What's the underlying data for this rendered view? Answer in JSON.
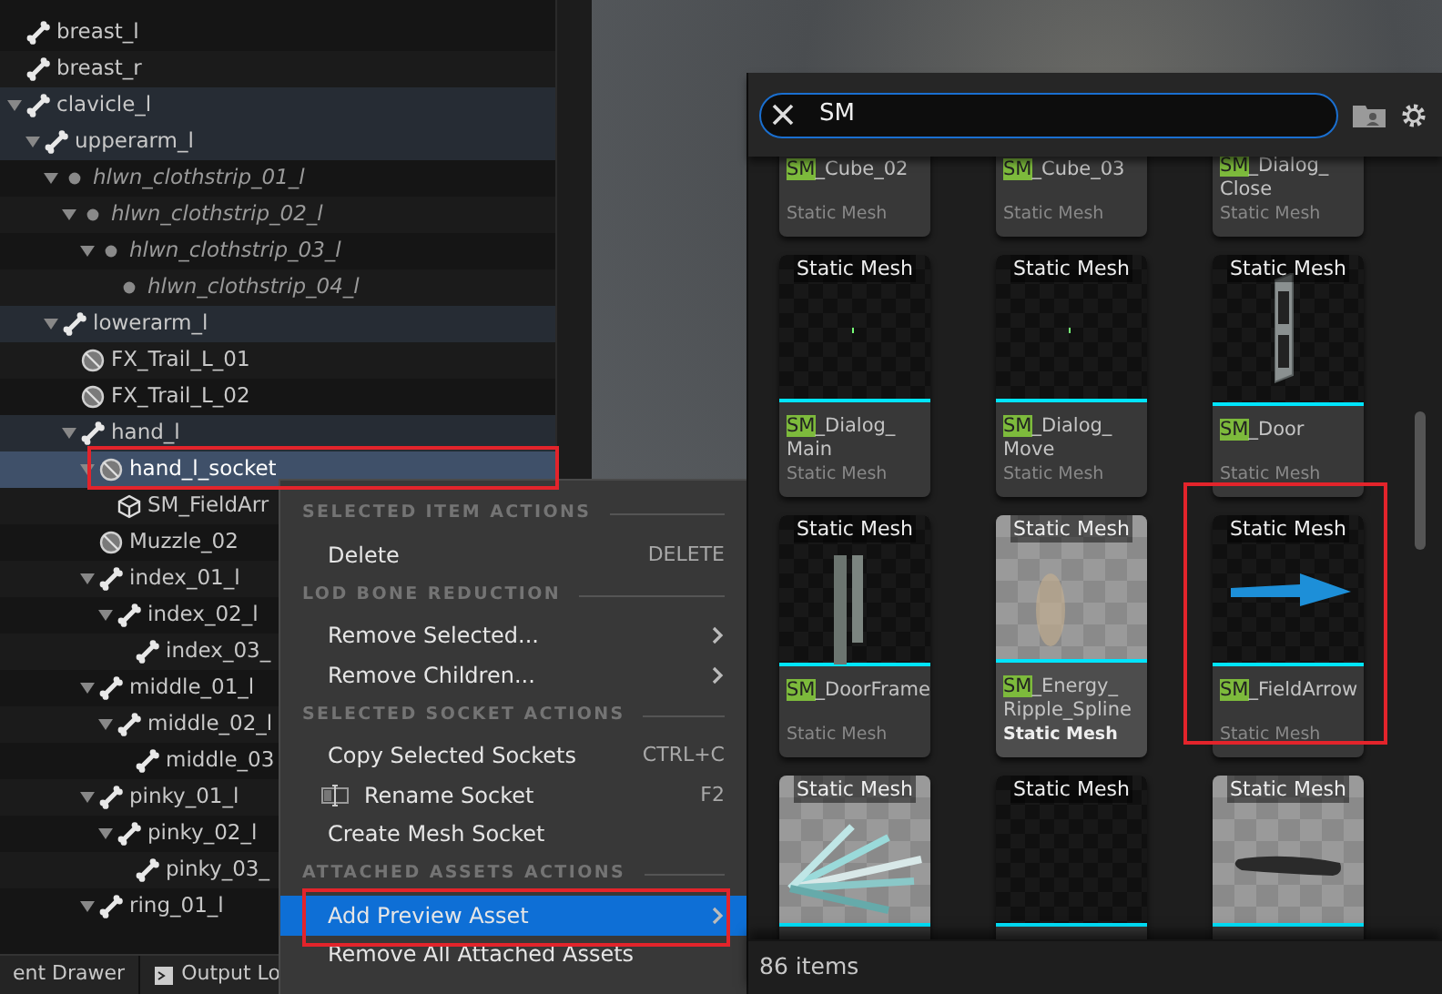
{
  "tree": [
    {
      "label": "breast_l",
      "kind": "bone",
      "selected": false,
      "in_path": false
    },
    {
      "label": "breast_r",
      "kind": "bone",
      "selected": false,
      "in_path": false
    },
    {
      "label": "clavicle_l",
      "kind": "bone",
      "selected": false,
      "in_path": true,
      "expanded": true,
      "children": [
        {
          "label": "upperarm_l",
          "kind": "bone",
          "selected": false,
          "in_path": true,
          "expanded": true,
          "children": [
            {
              "label": "hlwn_clothstrip_01_l",
              "kind": "virtual",
              "selected": false,
              "in_path": false,
              "expanded": true,
              "children": [
                {
                  "label": "hlwn_clothstrip_02_l",
                  "kind": "virtual",
                  "selected": false,
                  "in_path": false,
                  "expanded": true,
                  "children": [
                    {
                      "label": "hlwn_clothstrip_03_l",
                      "kind": "virtual",
                      "selected": false,
                      "in_path": false,
                      "expanded": true,
                      "children": [
                        {
                          "label": "hlwn_clothstrip_04_l",
                          "kind": "virtual",
                          "selected": false,
                          "in_path": false
                        }
                      ]
                    }
                  ]
                }
              ]
            },
            {
              "label": "lowerarm_l",
              "kind": "bone",
              "selected": false,
              "in_path": true,
              "expanded": true,
              "children": [
                {
                  "label": "FX_Trail_L_01",
                  "kind": "socket",
                  "selected": false,
                  "in_path": false
                },
                {
                  "label": "FX_Trail_L_02",
                  "kind": "socket",
                  "selected": false,
                  "in_path": false
                },
                {
                  "label": "hand_l",
                  "kind": "bone",
                  "selected": false,
                  "in_path": true,
                  "expanded": true,
                  "children": [
                    {
                      "label": "hand_l_socket",
                      "kind": "socket",
                      "selected": true,
                      "in_path": false,
                      "expanded": true,
                      "children": [
                        {
                          "label": "SM_FieldArr",
                          "kind": "mesh",
                          "selected": false,
                          "in_path": false
                        }
                      ]
                    },
                    {
                      "label": "Muzzle_02",
                      "kind": "socket",
                      "selected": false,
                      "in_path": false
                    },
                    {
                      "label": "index_01_l",
                      "kind": "bone",
                      "selected": false,
                      "in_path": false,
                      "expanded": true,
                      "children": [
                        {
                          "label": "index_02_l",
                          "kind": "bone",
                          "selected": false,
                          "in_path": false,
                          "expanded": true,
                          "children": [
                            {
                              "label": "index_03_",
                              "kind": "bone",
                              "selected": false,
                              "in_path": false
                            }
                          ]
                        }
                      ]
                    },
                    {
                      "label": "middle_01_l",
                      "kind": "bone",
                      "selected": false,
                      "in_path": false,
                      "expanded": true,
                      "children": [
                        {
                          "label": "middle_02_l",
                          "kind": "bone",
                          "selected": false,
                          "in_path": false,
                          "expanded": true,
                          "children": [
                            {
                              "label": "middle_03",
                              "kind": "bone",
                              "selected": false,
                              "in_path": false
                            }
                          ]
                        }
                      ]
                    },
                    {
                      "label": "pinky_01_l",
                      "kind": "bone",
                      "selected": false,
                      "in_path": false,
                      "expanded": true,
                      "children": [
                        {
                          "label": "pinky_02_l",
                          "kind": "bone",
                          "selected": false,
                          "in_path": false,
                          "expanded": true,
                          "children": [
                            {
                              "label": "pinky_03_",
                              "kind": "bone",
                              "selected": false,
                              "in_path": false
                            }
                          ]
                        }
                      ]
                    },
                    {
                      "label": "ring_01_l",
                      "kind": "bone",
                      "selected": false,
                      "in_path": false,
                      "expanded": true
                    }
                  ]
                }
              ]
            }
          ]
        }
      ]
    }
  ],
  "bottom_bar": [
    {
      "label": "ent Drawer",
      "icon": false
    },
    {
      "label": "Output Lo",
      "icon": true
    }
  ],
  "context_menu": [
    {
      "header": "SELECTED ITEM ACTIONS",
      "items": [
        {
          "label": "Delete",
          "shortcut": "DELETE",
          "submenu": false,
          "icon": false,
          "selected": false
        }
      ]
    },
    {
      "header": "LOD BONE REDUCTION",
      "items": [
        {
          "label": "Remove Selected...",
          "submenu": true,
          "icon": false,
          "selected": false
        },
        {
          "label": "Remove Children...",
          "submenu": true,
          "icon": false,
          "selected": false
        }
      ]
    },
    {
      "header": "SELECTED SOCKET ACTIONS",
      "items": [
        {
          "label": "Copy Selected Sockets",
          "shortcut": "CTRL+C",
          "submenu": false,
          "icon": false,
          "selected": false
        },
        {
          "label": "Rename Socket",
          "shortcut": "F2",
          "submenu": false,
          "icon": true,
          "selected": false
        },
        {
          "label": "Create Mesh Socket",
          "submenu": false,
          "icon": false,
          "selected": false
        }
      ]
    },
    {
      "header": "ATTACHED ASSETS ACTIONS",
      "items": [
        {
          "label": "Add Preview Asset",
          "submenu": true,
          "icon": false,
          "selected": true
        },
        {
          "label": "Remove All Attached Assets",
          "submenu": false,
          "icon": false,
          "selected": false
        }
      ]
    }
  ],
  "asset_picker": {
    "search": {
      "value": "SM"
    },
    "assets": [
      {
        "match": "SM",
        "rest": "_Cube_02",
        "type": "Static Mesh",
        "hovered": false
      },
      {
        "match": "SM",
        "rest": "_Cube_03",
        "type": "Static Mesh",
        "hovered": false
      },
      {
        "match": "SM",
        "rest": "_Dialog_\nClose",
        "type": "Static Mesh",
        "hovered": false
      },
      {
        "thumb_label": "Static Mesh",
        "kind": "dot",
        "match": "SM",
        "rest": "_Dialog_\nMain",
        "type": "Static Mesh",
        "hovered": false
      },
      {
        "thumb_label": "Static Mesh",
        "kind": "dot",
        "match": "SM",
        "rest": "_Dialog_\nMove",
        "type": "Static Mesh",
        "hovered": false
      },
      {
        "thumb_label": "Static Mesh",
        "kind": "door",
        "match": "SM",
        "rest": "_Door",
        "type": "Static Mesh",
        "hovered": false
      },
      {
        "thumb_label": "Static Mesh",
        "kind": "doorframe",
        "match": "SM",
        "rest": "_DoorFrame",
        "type": "Static Mesh",
        "hovered": false
      },
      {
        "thumb_label": "Static Mesh",
        "kind": "floor",
        "match": "SM",
        "rest": "_Energy_\nRipple_Spline",
        "type": "Static Mesh",
        "hovered": true
      },
      {
        "thumb_label": "Static Mesh",
        "kind": "arrow",
        "match": "SM",
        "rest": "_FieldArrow",
        "type": "Static Mesh",
        "hovered": false
      },
      {
        "thumb_label": "Static Mesh",
        "kind": "shards",
        "hovered": false
      },
      {
        "thumb_label": "Static Mesh",
        "kind": "empty",
        "hovered": false
      },
      {
        "thumb_label": "Static Mesh",
        "kind": "grub",
        "hovered": false
      }
    ],
    "count": "86 items"
  }
}
